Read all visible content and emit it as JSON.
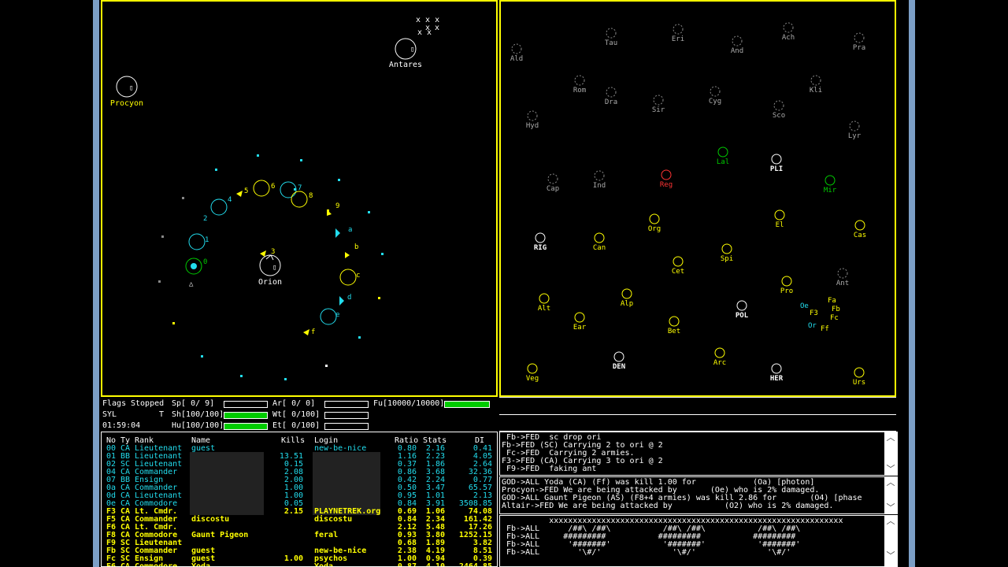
{
  "tactical": {
    "planets": [
      {
        "name": "Antares",
        "color": "#ffffff"
      },
      {
        "name": "Procyon",
        "color": "#ffff00"
      },
      {
        "name": "Orion",
        "color": "#ffffff"
      }
    ],
    "ship_labels": [
      "0",
      "1",
      "2",
      "4",
      "5",
      "6",
      "7",
      "8",
      "9",
      "a",
      "b",
      "c",
      "d",
      "e",
      "f",
      "3"
    ]
  },
  "galactic": {
    "planets": [
      {
        "name": "Ald",
        "color": "#aaaaaa"
      },
      {
        "name": "Tau",
        "color": "#aaaaaa"
      },
      {
        "name": "Eri",
        "color": "#aaaaaa"
      },
      {
        "name": "And",
        "color": "#aaaaaa"
      },
      {
        "name": "Ach",
        "color": "#aaaaaa"
      },
      {
        "name": "Pra",
        "color": "#aaaaaa"
      },
      {
        "name": "Rom",
        "color": "#aaaaaa"
      },
      {
        "name": "Dra",
        "color": "#aaaaaa"
      },
      {
        "name": "Sir",
        "color": "#aaaaaa"
      },
      {
        "name": "Cyg",
        "color": "#aaaaaa"
      },
      {
        "name": "Kli",
        "color": "#aaaaaa"
      },
      {
        "name": "Sco",
        "color": "#aaaaaa"
      },
      {
        "name": "Hyd",
        "color": "#aaaaaa"
      },
      {
        "name": "Lyr",
        "color": "#aaaaaa"
      },
      {
        "name": "Lal",
        "color": "#00cc00"
      },
      {
        "name": "PLI",
        "color": "#ffffff"
      },
      {
        "name": "Cap",
        "color": "#aaaaaa"
      },
      {
        "name": "Ind",
        "color": "#aaaaaa"
      },
      {
        "name": "Reg",
        "color": "#ff3333"
      },
      {
        "name": "Mir",
        "color": "#00cc00"
      },
      {
        "name": "El",
        "color": "#ffff00"
      },
      {
        "name": "Org",
        "color": "#ffff00"
      },
      {
        "name": "Cas",
        "color": "#ffff00"
      },
      {
        "name": "RIG",
        "color": "#ffffff"
      },
      {
        "name": "Can",
        "color": "#ffff00"
      },
      {
        "name": "Spi",
        "color": "#ffff00"
      },
      {
        "name": "Cet",
        "color": "#ffff00"
      },
      {
        "name": "Ant",
        "color": "#aaaaaa"
      },
      {
        "name": "Pro",
        "color": "#ffff00"
      },
      {
        "name": "Alt",
        "color": "#ffff00"
      },
      {
        "name": "Alp",
        "color": "#ffff00"
      },
      {
        "name": "POL",
        "color": "#ffffff"
      },
      {
        "name": "Ear",
        "color": "#ffff00"
      },
      {
        "name": "Bet",
        "color": "#ffff00"
      },
      {
        "name": "DEN",
        "color": "#ffffff"
      },
      {
        "name": "Arc",
        "color": "#ffff00"
      },
      {
        "name": "Veg",
        "color": "#ffff00"
      },
      {
        "name": "HER",
        "color": "#ffffff"
      },
      {
        "name": "Urs",
        "color": "#ffff00"
      }
    ],
    "ship_tags": [
      "Fa",
      "Fb",
      "Fc",
      "F3",
      "Ff",
      "Or",
      "Oe"
    ]
  },
  "status": {
    "flags_label": "Flags",
    "flags_value": "Stopped",
    "player": "SYL",
    "t": "T",
    "time": "01:59:04",
    "sp": "Sp[ 0/ 9]",
    "sh": "Sh[100/100]",
    "hu": "Hu[100/100]",
    "ar": "Ar[ 0/ 0]",
    "wt": "Wt[ 0/100]",
    "et": "Et[ 0/100]",
    "fu": "Fu[10000/10000]",
    "sh_fill": 1.0,
    "hu_fill": 1.0,
    "fu_fill": 1.0,
    "sp_fill": 0.0,
    "ar_fill": 0.0,
    "wt_fill": 0.0,
    "et_fill": 0.0
  },
  "players": {
    "header": {
      "no": "No",
      "ty": "Ty",
      "rank": "Rank",
      "name": "Name",
      "kills": "Kills",
      "login": "Login",
      "ratio": "Ratio",
      "stats": "Stats",
      "di": "DI"
    },
    "rows": [
      {
        "no": "00",
        "ty": "CA",
        "rank": "Lieutenant",
        "name": "guest",
        "kills": "",
        "login": "new-be-nice",
        "ratio": "0.80",
        "stats": "2.16",
        "di": "0.41",
        "color": "#22ddee"
      },
      {
        "no": "01",
        "ty": "BB",
        "rank": "Lieutenant",
        "name": "",
        "kills": "13.51",
        "login": "",
        "ratio": "1.16",
        "stats": "2.23",
        "di": "4.05",
        "color": "#22ddee"
      },
      {
        "no": "02",
        "ty": "SC",
        "rank": "Lieutenant",
        "name": "",
        "kills": "0.15",
        "login": "",
        "ratio": "0.37",
        "stats": "1.86",
        "di": "2.64",
        "color": "#22ddee"
      },
      {
        "no": "04",
        "ty": "CA",
        "rank": "Commander",
        "name": "",
        "kills": "2.08",
        "login": "",
        "ratio": "0.86",
        "stats": "3.68",
        "di": "32.36",
        "color": "#22ddee"
      },
      {
        "no": "07",
        "ty": "BB",
        "rank": "Ensign",
        "name": "",
        "kills": "2.00",
        "login": "",
        "ratio": "0.42",
        "stats": "2.24",
        "di": "0.77",
        "color": "#22ddee"
      },
      {
        "no": "0a",
        "ty": "CA",
        "rank": "Commander",
        "name": "",
        "kills": "1.00",
        "login": "",
        "ratio": "0.50",
        "stats": "3.47",
        "di": "65.57",
        "color": "#22ddee"
      },
      {
        "no": "0d",
        "ty": "CA",
        "rank": "Lieutenant",
        "name": "",
        "kills": "1.00",
        "login": "",
        "ratio": "0.95",
        "stats": "1.01",
        "di": "2.13",
        "color": "#22ddee"
      },
      {
        "no": "0e",
        "ty": "CA",
        "rank": "Commodore",
        "name": "",
        "kills": "0.05",
        "login": "",
        "ratio": "0.84",
        "stats": "3.91",
        "di": "3508.85",
        "color": "#22ddee"
      },
      {
        "no": "F3",
        "ty": "CA",
        "rank": "Lt. Cmdr.",
        "name": "",
        "kills": "2.15",
        "login": "PLAYNETREK.org",
        "ratio": "0.69",
        "stats": "1.06",
        "di": "74.08",
        "color": "#ffff00"
      },
      {
        "no": "F5",
        "ty": "CA",
        "rank": "Commander",
        "name": "discostu",
        "kills": "",
        "login": "discostu",
        "ratio": "0.84",
        "stats": "2.34",
        "di": "161.42",
        "color": "#ffff00"
      },
      {
        "no": "F6",
        "ty": "CA",
        "rank": "Lt. Cmdr.",
        "name": "",
        "kills": "",
        "login": "",
        "ratio": "2.12",
        "stats": "5.48",
        "di": "17.26",
        "color": "#ffff00"
      },
      {
        "no": "F8",
        "ty": "CA",
        "rank": "Commodore",
        "name": "Gaunt Pigeon",
        "kills": "",
        "login": "feral",
        "ratio": "0.93",
        "stats": "3.80",
        "di": "1252.15",
        "color": "#ffff00"
      },
      {
        "no": "F9",
        "ty": "SC",
        "rank": "Lieutenant",
        "name": "",
        "kills": "",
        "login": "",
        "ratio": "0.68",
        "stats": "1.89",
        "di": "3.82",
        "color": "#ffff00"
      },
      {
        "no": "Fb",
        "ty": "SC",
        "rank": "Commander",
        "name": "guest",
        "kills": "",
        "login": "new-be-nice",
        "ratio": "2.38",
        "stats": "4.19",
        "di": "8.51",
        "color": "#ffff00"
      },
      {
        "no": "Fc",
        "ty": "SC",
        "rank": "Ensign",
        "name": "guest",
        "kills": "1.00",
        "login": "psychos",
        "ratio": "1.00",
        "stats": "0.94",
        "di": "0.39",
        "color": "#ffff00"
      },
      {
        "no": "F6",
        "ty": "CA",
        "rank": "Commodore",
        "name": "Yoda",
        "kills": "",
        "login": "Yoda",
        "ratio": "0.87",
        "stats": "4.10",
        "di": "2464.85",
        "color": "#ffff00"
      }
    ]
  },
  "messages": {
    "team": [
      " Fb->FED  sc drop ori",
      "Fb->FED (SC) Carrying 2 to ori @ 2",
      " Fc->FED  Carrying 2 armies.",
      "F3->FED (CA) Carrying 3 to ori @ 2",
      " F9->FED  faking ant"
    ],
    "all": [
      "GOD->ALL Yoda (CA) (Ff) was kill 1.00 for            (Oa) [photon]",
      "Procyon->FED We are being attacked by       (Oe) who is 2% damaged.",
      "GOD->ALL Gaunt Pigeon (AS) (F8+4 armies) was kill 2.86 for       (O4) [phase",
      "Altair->FED We are being attacked by           (O2) who is 2% damaged."
    ],
    "art": [
      "          xxxxxxxxxxxxxxxxxxxxxxxxxxxxxxxxxxxxxxxxxxxxxxxxxxxxxxxxxxxxxx",
      " Fb->ALL      /##\\ /##\\           /##\\ /##\\           /##\\ /##\\",
      " Fb->ALL     #########           #########           #########",
      " Fb->ALL      '#######'           '#######'           '#######'",
      " Fb->ALL        '\\#/'               '\\#/'               '\\#/'"
    ],
    "bottom": "GOD->Fxx  ...  ...  ..."
  }
}
